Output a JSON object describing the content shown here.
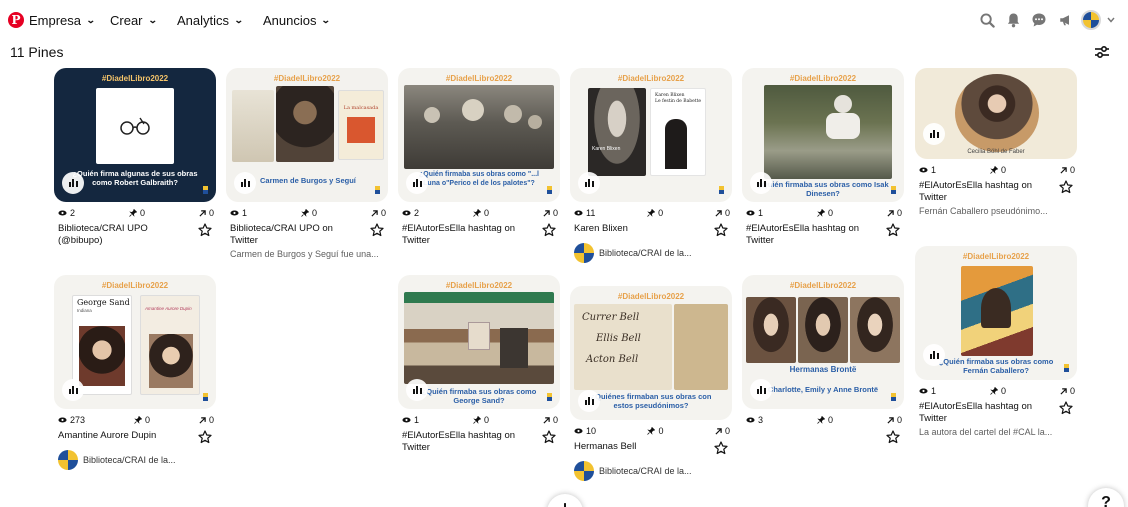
{
  "header": {
    "logo": "P",
    "nav": [
      "Empresa",
      "Crear",
      "Analytics",
      "Anuncios"
    ],
    "icons": [
      "search-icon",
      "bell-icon",
      "chat-icon",
      "megaphone-icon",
      "account-avatar",
      "chevron-down-icon"
    ]
  },
  "section": {
    "title": "11 Pines"
  },
  "colors": {
    "brand": "#e60023",
    "tag": "#e7a14a",
    "caption": "#2b5fa7"
  },
  "pins": [
    {
      "tag": "#DiadelLibro2022",
      "caption": "¿Quién firma algunas de sus obras como Robert Galbraith?",
      "views": "2",
      "saves": "0",
      "clicks": "0",
      "title": "Biblioteca/CRAI UPO (@bibupo)",
      "desc": "",
      "author": ""
    },
    {
      "tag": "#DiadelLibro2022",
      "caption": "Carmen de Burgos y Seguí",
      "views": "1",
      "saves": "0",
      "clicks": "0",
      "title": "Biblioteca/CRAI UPO on Twitter",
      "desc": "Carmen de Burgos y Seguí fue una...",
      "author": ""
    },
    {
      "tag": "#DiadelLibro2022",
      "caption": "¿Quién firmaba sus obras como \"Colombine\", \"Raquel\", \"Marianela\", \"Perico el de los palotes\"?",
      "caption_short": "¿Quién firmaba sus obras como \"...l Luna o\"Perico el de los palotes\"?",
      "views": "2",
      "saves": "0",
      "clicks": "0",
      "title": "#ElAutorEsElla hashtag on Twitter",
      "desc": "",
      "author": ""
    },
    {
      "tag": "#DiadelLibro2022",
      "caption": "",
      "views": "11",
      "saves": "0",
      "clicks": "0",
      "title": "Karen Blixen",
      "desc": "",
      "author": "Biblioteca/CRAI de la..."
    },
    {
      "tag": "#DiadelLibro2022",
      "caption": "¿Quién firmaba sus obras como Isak Dinesen?",
      "views": "1",
      "saves": "0",
      "clicks": "0",
      "title": "#ElAutorEsElla hashtag on Twitter",
      "desc": "",
      "author": ""
    },
    {
      "tag": "",
      "caption": "Cecilia Böhl de Faber",
      "views": "1",
      "saves": "0",
      "clicks": "0",
      "title": "#ElAutorEsElla hashtag on Twitter",
      "desc": "Fernán Caballero pseudónimo...",
      "author": ""
    },
    {
      "tag": "#DiadelLibro2022",
      "caption": "",
      "views": "273",
      "saves": "0",
      "clicks": "0",
      "title": "Amantine Aurore Dupin",
      "desc": "",
      "author": "Biblioteca/CRAI de la..."
    },
    {
      "tag": "#DiadelLibro2022",
      "caption": "¿Quién firmaba sus obras como George Sand?",
      "views": "1",
      "saves": "0",
      "clicks": "0",
      "title": "#ElAutorEsElla hashtag on Twitter",
      "desc": "",
      "author": ""
    },
    {
      "tag": "#DiadelLibro2022",
      "caption": "¿Quiénes firmaban sus obras con estos pseudónimos?",
      "views": "10",
      "saves": "0",
      "clicks": "0",
      "title": "Hermanas Bell",
      "desc": "",
      "author": "Biblioteca/CRAI de la..."
    },
    {
      "tag": "#DiadelLibro2022",
      "caption": "Charlotte, Emily y Anne Brontë",
      "heading": "Hermanas Brontë",
      "views": "3",
      "saves": "0",
      "clicks": "0",
      "title": "",
      "desc": "",
      "author": ""
    },
    {
      "tag": "#DiadelLibro2022",
      "caption": "¿Quién firmaba sus obras como Fernán Caballero?",
      "views": "1",
      "saves": "0",
      "clicks": "0",
      "title": "#ElAutorEsElla hashtag on Twitter",
      "desc": "La autora del cartel del #CAL la...",
      "author": ""
    }
  ],
  "photo_texts": {
    "p3_book": "Karen Blixen",
    "p4_book": "Karen Blixen\nLe festin de Babette",
    "p7_sand": "George Sand",
    "p7_sub": "Indiana",
    "p7_book2": "Amantine Aurore Dupin",
    "p9_sign1": "Currer Bell",
    "p9_sign2": "Ellis Bell",
    "p9_sign3": "Acton Bell",
    "p2_book": "La malcasada"
  },
  "fab": {
    "left": "+",
    "right": "?"
  }
}
